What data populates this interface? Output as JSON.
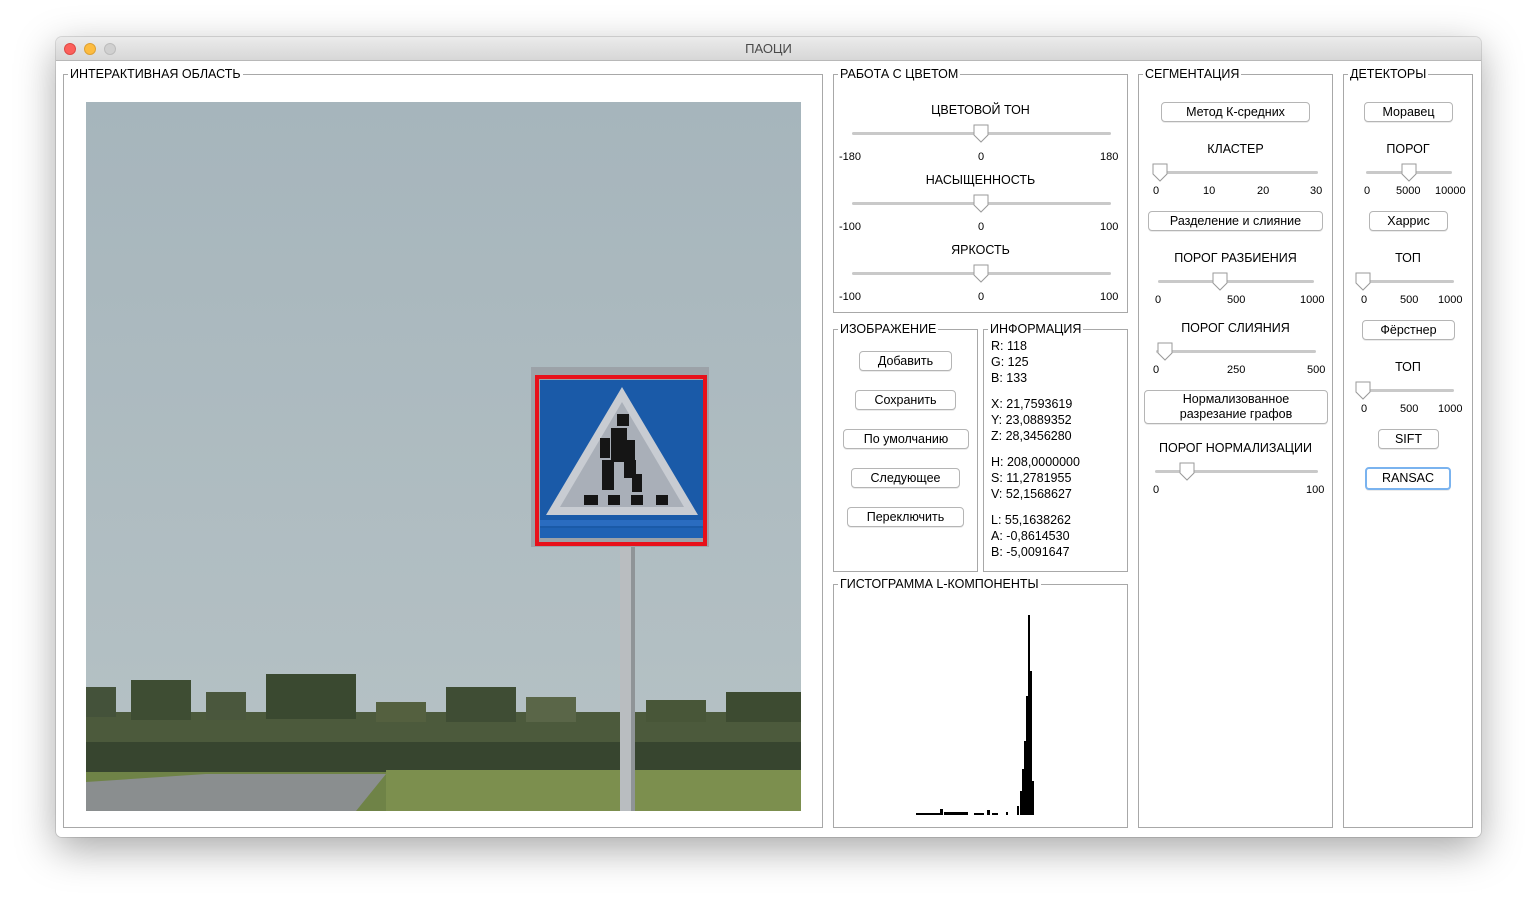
{
  "window": {
    "title": "ПАОЦИ"
  },
  "interactive": {
    "title": "ИНТЕРАКТИВНАЯ ОБЛАСТЬ"
  },
  "color": {
    "title": "РАБОТА С ЦВЕТОМ",
    "hue": {
      "label": "ЦВЕТОВОЙ ТОН",
      "min": "-180",
      "mid": "0",
      "max": "180",
      "value": 0
    },
    "saturation": {
      "label": "НАСЫЩЕННОСТЬ",
      "min": "-100",
      "mid": "0",
      "max": "100",
      "value": 0
    },
    "brightness": {
      "label": "ЯРКОСТЬ",
      "min": "-100",
      "mid": "0",
      "max": "100",
      "value": 0
    }
  },
  "image": {
    "title": "ИЗОБРАЖЕНИЕ",
    "add": "Добавить",
    "save": "Сохранить",
    "default": "По умолчанию",
    "next": "Следующее",
    "switch": "Переключить"
  },
  "info": {
    "title": "ИНФОРМАЦИЯ",
    "r": "R: 118",
    "g": "G: 125",
    "b": "B: 133",
    "x": "X: 21,7593619",
    "y": "Y: 23,0889352",
    "z": "Z: 28,3456280",
    "h": "H: 208,0000000",
    "s": "S: 11,2781955",
    "v": "V: 52,1568627",
    "l": "L: 55,1638262",
    "a": "A: -0,8614530",
    "lab_b": "B: -5,0091647"
  },
  "histogram": {
    "title": "ГИСТОГРАММА L-КОМПОНЕНТЫ"
  },
  "segmentation": {
    "title": "СЕГМЕНТАЦИЯ",
    "kmeans": "Метод К-средних",
    "cluster": {
      "label": "КЛАСТЕР",
      "ticks": [
        "0",
        "10",
        "20",
        "30"
      ],
      "value": 0
    },
    "split_merge": "Разделение и слияние",
    "split_threshold": {
      "label": "ПОРОГ РАЗБИЕНИЯ",
      "ticks": [
        "0",
        "500",
        "1000"
      ],
      "value": 400
    },
    "merge_threshold": {
      "label": "ПОРОГ СЛИЯНИЯ",
      "ticks": [
        "0",
        "250",
        "500"
      ],
      "value": 25
    },
    "ncut": "Нормализованное\nразрезание графов",
    "ncut_line1": "Нормализованное",
    "ncut_line2": "разрезание графов",
    "norm_threshold": {
      "label": "ПОРОГ НОРМАЛИЗАЦИИ",
      "ticks": [
        "0",
        "100"
      ],
      "value": 20
    }
  },
  "detectors": {
    "title": "ДЕТЕКТОРЫ",
    "moravec": "Моравец",
    "moravec_threshold": {
      "label": "ПОРОГ",
      "ticks": [
        "0",
        "5000",
        "10000"
      ],
      "value": 5000
    },
    "harris": "Харрис",
    "harris_top": {
      "label": "ТОП",
      "ticks": [
        "0",
        "500",
        "1000"
      ],
      "value": 0
    },
    "forstner": "Фёрстнер",
    "forstner_top": {
      "label": "ТОП",
      "ticks": [
        "0",
        "500",
        "1000"
      ],
      "value": 0
    },
    "sift": "SIFT",
    "ransac": "RANSAC"
  },
  "colors": {
    "selection_box": "#e8101a",
    "sign_blue": "#1a5aa8",
    "sky": "#a9b7be"
  }
}
